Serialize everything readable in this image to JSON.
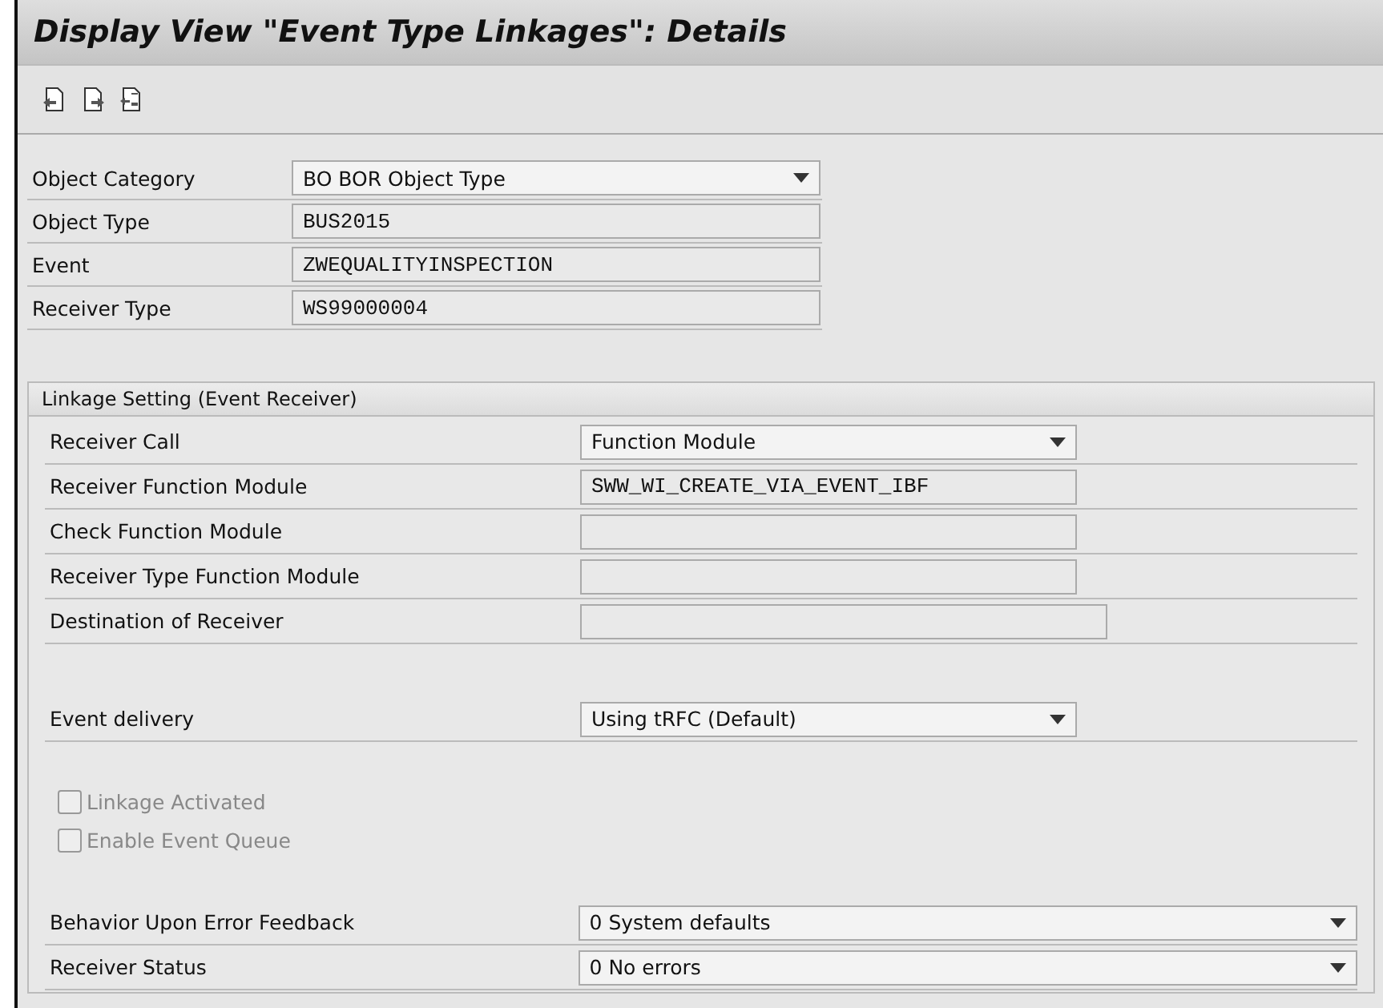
{
  "window": {
    "title": "Display View \"Event Type Linkages\": Details"
  },
  "toolbar": {
    "buttons": [
      {
        "kind": "previous"
      },
      {
        "kind": "next"
      },
      {
        "kind": "other"
      }
    ]
  },
  "header_fields": [
    {
      "label": "Object Category",
      "kind": "dropdown",
      "value": "BO BOR Object Type"
    },
    {
      "label": "Object Type",
      "kind": "input",
      "value": "BUS2015"
    },
    {
      "label": "Event",
      "kind": "input",
      "value": "ZWEQUALITYINSPECTION"
    },
    {
      "label": "Receiver Type",
      "kind": "input",
      "value": "WS99000004"
    }
  ],
  "linkage_group": {
    "title": "Linkage Setting (Event Receiver)",
    "fields": [
      {
        "label": "Receiver Call",
        "kind": "dropdown",
        "value": "Function Module"
      },
      {
        "label": "Receiver Function Module",
        "kind": "input",
        "value": "SWW_WI_CREATE_VIA_EVENT_IBF"
      },
      {
        "label": "Check Function Module",
        "kind": "input"
      },
      {
        "label": "Receiver Type Function Module",
        "kind": "input"
      },
      {
        "label": "Destination of Receiver",
        "kind": "input_long"
      }
    ],
    "delivery": {
      "label": "Event delivery",
      "kind": "dropdown",
      "value": "Using tRFC (Default)"
    },
    "checkboxes": [
      {
        "label": "Linkage Activated",
        "checked": false,
        "disabled": true
      },
      {
        "label": "Enable Event Queue",
        "checked": false,
        "disabled": true
      }
    ],
    "bottom_fields": [
      {
        "label": "Behavior Upon Error Feedback",
        "kind": "dropdown_wide",
        "value": "0 System defaults"
      },
      {
        "label": "Receiver Status",
        "kind": "dropdown_wide",
        "value": "0 No errors"
      }
    ]
  }
}
